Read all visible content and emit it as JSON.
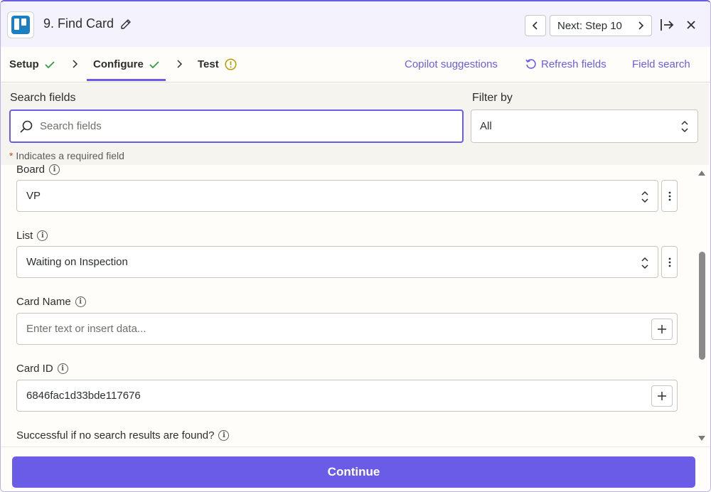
{
  "header": {
    "step_title": "9. Find Card",
    "next_label": "Next: Step 10"
  },
  "tabs": [
    {
      "label": "Setup",
      "status": "complete"
    },
    {
      "label": "Configure",
      "status": "complete"
    },
    {
      "label": "Test",
      "status": "warning"
    }
  ],
  "toolbar": {
    "copilot": "Copilot suggestions",
    "refresh": "Refresh fields",
    "field_search": "Field search"
  },
  "search": {
    "label": "Search fields",
    "placeholder": "Search fields",
    "filter_label": "Filter by",
    "filter_value": "All",
    "required_note": "Indicates a required field",
    "required_mark": "*"
  },
  "fields": {
    "board": {
      "label": "Board",
      "value": "VP"
    },
    "list": {
      "label": "List",
      "value": "Waiting on Inspection"
    },
    "card_name": {
      "label": "Card Name",
      "value": "",
      "placeholder": "Enter text or insert data..."
    },
    "card_id": {
      "label": "Card ID",
      "value": "6846fac1d33bde117676"
    },
    "success_if_none": {
      "label": "Successful if no search results are found?"
    }
  },
  "footer": {
    "continue_label": "Continue"
  },
  "colors": {
    "accent": "#6b5ce7",
    "success": "#2f9e44",
    "warning": "#b99a00",
    "trello": "#1d7ec0"
  }
}
